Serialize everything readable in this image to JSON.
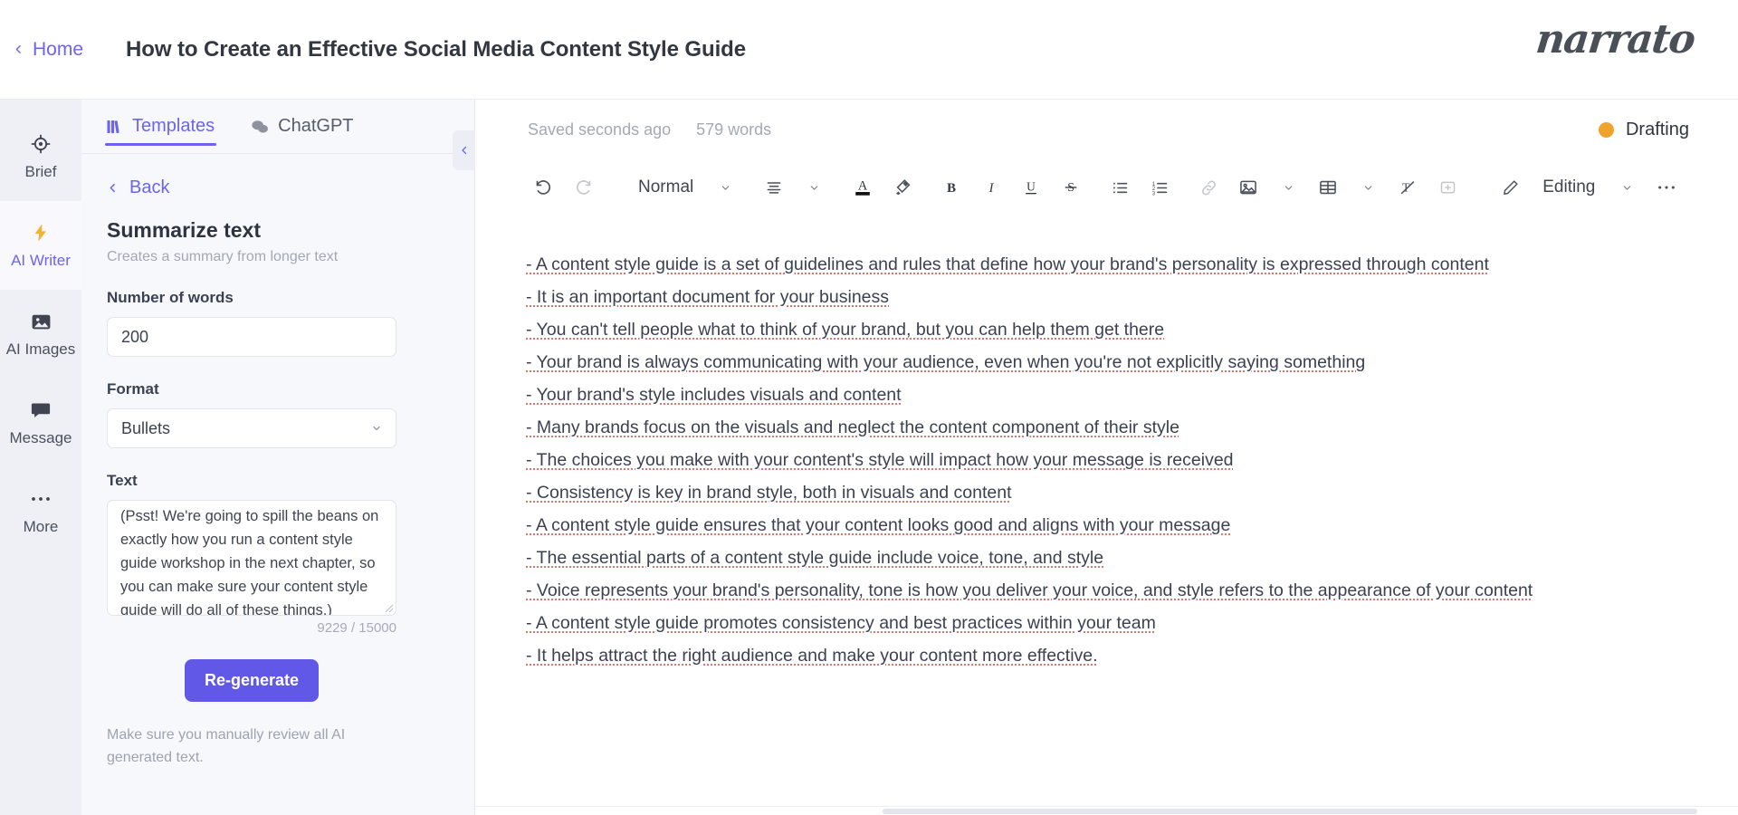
{
  "topbar": {
    "home_label": "Home",
    "doc_title": "How to Create an Effective Social Media Content Style Guide",
    "logo_text": "narrato"
  },
  "rail": {
    "items": [
      {
        "label": "Brief",
        "icon": "target-icon",
        "active": false
      },
      {
        "label": "AI Writer",
        "icon": "lightning-icon",
        "active": true
      },
      {
        "label": "AI Images",
        "icon": "image-icon",
        "active": false
      },
      {
        "label": "Message",
        "icon": "chat-bubble-icon",
        "active": false
      },
      {
        "label": "More",
        "icon": "ellipsis-icon",
        "active": false
      }
    ]
  },
  "panel": {
    "tabs": [
      {
        "label": "Templates",
        "icon": "templates-icon",
        "active": true
      },
      {
        "label": "ChatGPT",
        "icon": "chat-icon",
        "active": false
      }
    ],
    "back_label": "Back",
    "template_title": "Summarize text",
    "template_subtitle": "Creates a summary from longer text",
    "fields": {
      "words_label": "Number of words",
      "words_value": "200",
      "format_label": "Format",
      "format_value": "Bullets",
      "text_label": "Text",
      "text_value": "(Psst! We're going to spill the beans on exactly how you run a content style guide workshop in the next chapter, so you can make sure your content style guide will do all of these things.)",
      "char_count": "9229 / 15000"
    },
    "regenerate_label": "Re-generate",
    "disclaimer": "Make sure you manually review all AI generated text."
  },
  "editor": {
    "saved_status": "Saved seconds ago",
    "word_count": "579 words",
    "doc_state": "Drafting",
    "state_color": "#f0a32a",
    "toolbar": {
      "undo": "undo-icon",
      "redo": "redo-icon",
      "style_label": "Normal",
      "mode_label": "Editing",
      "items": [
        "align-icon",
        "text-color-icon",
        "highlight-icon",
        "bold-icon",
        "italic-icon",
        "underline-icon",
        "strikethrough-icon",
        "bullet-list-icon",
        "numbered-list-icon",
        "link-icon",
        "image-icon",
        "table-icon",
        "clear-format-icon",
        "comment-icon"
      ]
    },
    "content_lines": [
      "- A content style guide is a set of guidelines and rules that define how your brand's personality is expressed through content",
      "- It is an important document for your business",
      "- You can't tell people what to think of your brand, but you can help them get there",
      "- Your brand is always communicating with your audience, even when you're not explicitly saying something",
      "- Your brand's style includes visuals and content",
      "- Many brands focus on the visuals and neglect the content component of their style",
      "- The choices you make with your content's style will impact how your message is received",
      "- Consistency is key in brand style, both in visuals and content",
      "- A content style guide ensures that your content looks good and aligns with your message",
      "- The essential parts of a content style guide include voice, tone, and style",
      "- Voice represents your brand's personality, tone is how you deliver your voice, and style refers to the appearance of your content",
      "- A content style guide promotes consistency and best practices within your team",
      "- It helps attract the right audience and make your content more effective."
    ]
  },
  "colors": {
    "accent": "#6c63f2",
    "button": "#6258e8",
    "rail_bg": "#eef0f6",
    "panel_bg": "#f7f8fc",
    "spell_underline": "#e2706a"
  }
}
